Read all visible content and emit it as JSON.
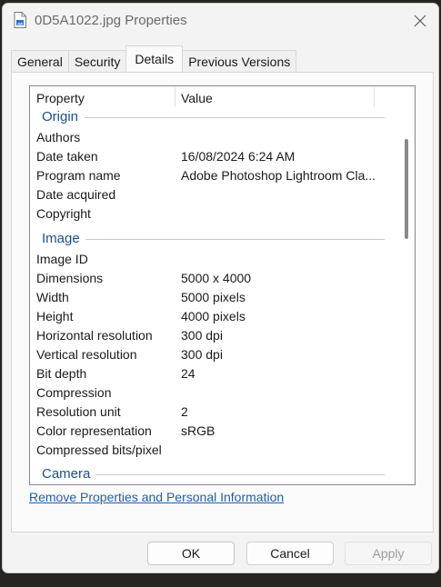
{
  "window": {
    "title": "0D5A1022.jpg Properties"
  },
  "tabs": [
    {
      "label": "General"
    },
    {
      "label": "Security"
    },
    {
      "label": "Details"
    },
    {
      "label": "Previous Versions"
    }
  ],
  "list": {
    "col_property": "Property",
    "col_value": "Value",
    "groups": {
      "origin": "Origin",
      "image": "Image",
      "camera": "Camera"
    },
    "rows": [
      {
        "prop": "Authors",
        "val": ""
      },
      {
        "prop": "Date taken",
        "val": "16/08/2024 6:24 AM"
      },
      {
        "prop": "Program name",
        "val": "Adobe Photoshop Lightroom Cla..."
      },
      {
        "prop": "Date acquired",
        "val": ""
      },
      {
        "prop": "Copyright",
        "val": ""
      },
      {
        "prop": "Image ID",
        "val": ""
      },
      {
        "prop": "Dimensions",
        "val": "5000 x 4000"
      },
      {
        "prop": "Width",
        "val": "5000 pixels"
      },
      {
        "prop": "Height",
        "val": "4000 pixels"
      },
      {
        "prop": "Horizontal resolution",
        "val": "300 dpi"
      },
      {
        "prop": "Vertical resolution",
        "val": "300 dpi"
      },
      {
        "prop": "Bit depth",
        "val": "24"
      },
      {
        "prop": "Compression",
        "val": ""
      },
      {
        "prop": "Resolution unit",
        "val": "2"
      },
      {
        "prop": "Color representation",
        "val": "sRGB"
      },
      {
        "prop": "Compressed bits/pixel",
        "val": ""
      }
    ]
  },
  "remove_link": "Remove Properties and Personal Information",
  "buttons": {
    "ok": "OK",
    "cancel": "Cancel",
    "apply": "Apply"
  },
  "icons": {
    "title_icon": "jpg-file-icon",
    "close": "close-icon"
  }
}
